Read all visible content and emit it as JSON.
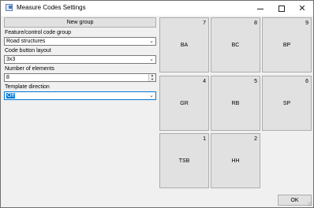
{
  "window": {
    "title": "Measure Codes Settings",
    "controls": {
      "minimize": "minimize",
      "maximize": "maximize",
      "close": "close"
    }
  },
  "form": {
    "new_group_label": "New group",
    "feature_group": {
      "label": "Feature/control code group",
      "value": "Road structures"
    },
    "layout": {
      "label": "Code button layout",
      "value": "3x3"
    },
    "elements": {
      "label": "Number of elements",
      "value": "8"
    },
    "direction": {
      "label": "Template direction",
      "value": "Off"
    }
  },
  "tiles": [
    {
      "number": "7",
      "code": "BA"
    },
    {
      "number": "8",
      "code": "BC"
    },
    {
      "number": "9",
      "code": "BP"
    },
    {
      "number": "4",
      "code": "GR"
    },
    {
      "number": "5",
      "code": "RB"
    },
    {
      "number": "6",
      "code": "SP"
    },
    {
      "number": "1",
      "code": "TSB"
    },
    {
      "number": "2",
      "code": "HH"
    }
  ],
  "ok_label": "OK",
  "colors": {
    "accent": "#0078d7",
    "button_face": "#e1e1e1",
    "window_bg": "#f0f0f0"
  }
}
